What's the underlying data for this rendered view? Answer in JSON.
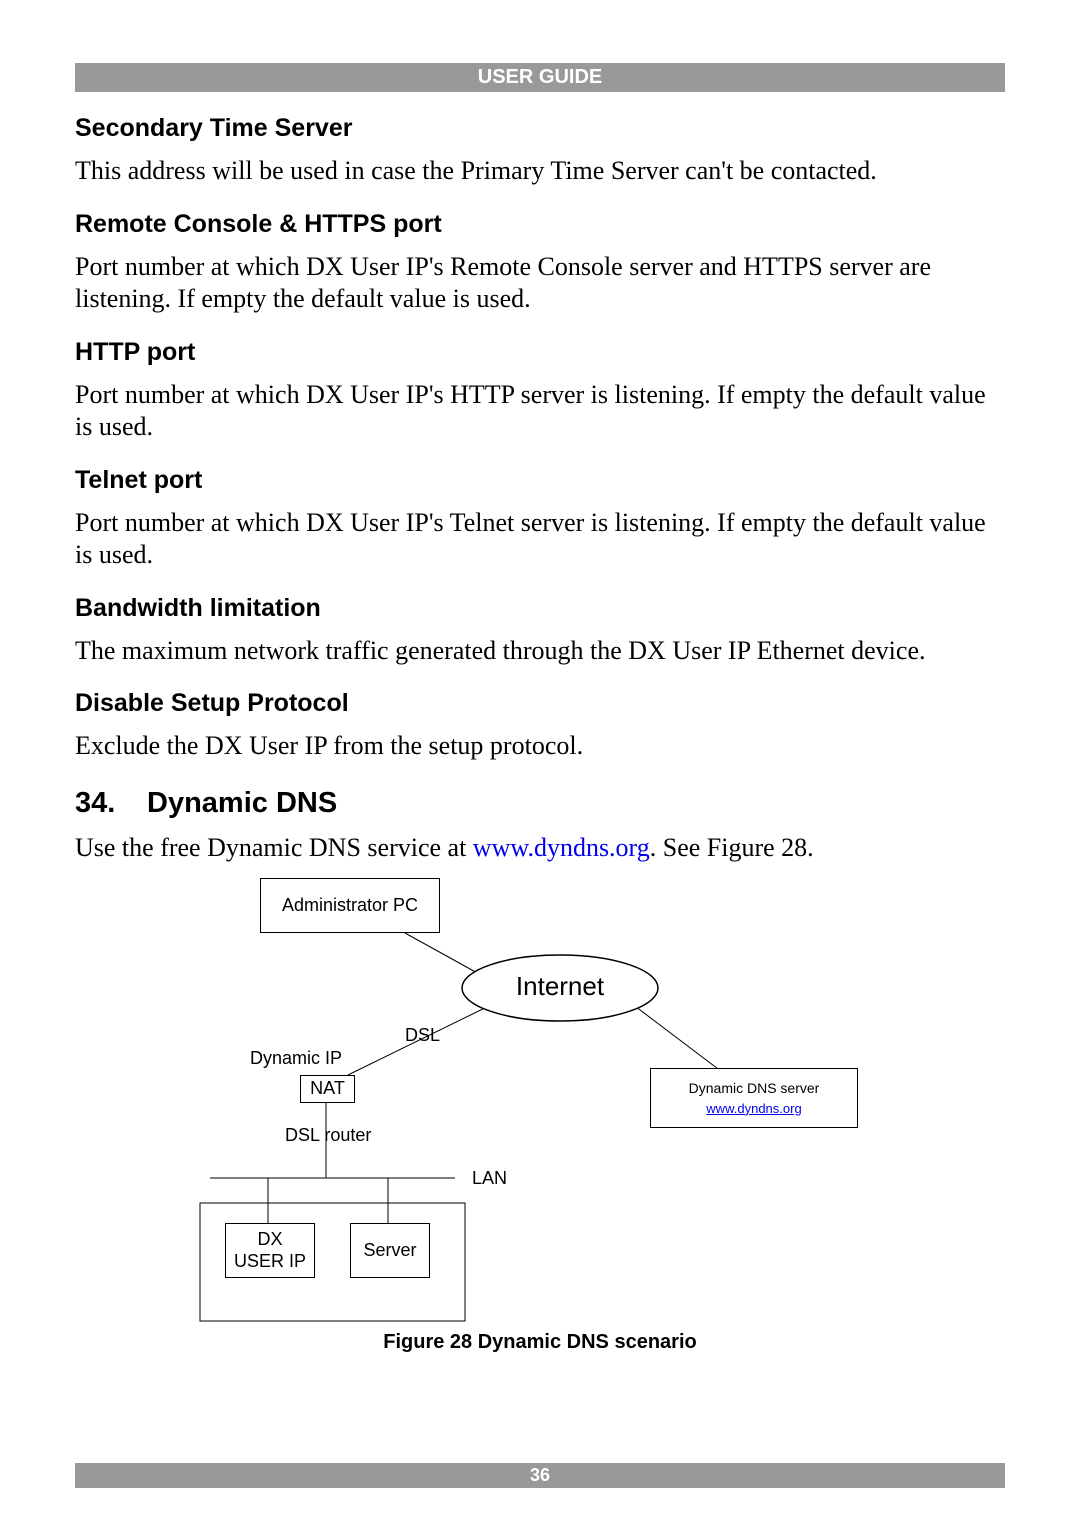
{
  "header": "USER GUIDE",
  "sections": {
    "s1_title": "Secondary Time Server",
    "s1_body": "This address will be used in case the Primary Time Server can't be contacted.",
    "s2_title": "Remote Console & HTTPS port",
    "s2_body": "Port number at which DX User IP's Remote Console server and HTTPS server are listening. If empty the default value is used.",
    "s3_title": "HTTP port",
    "s3_body": "Port number at which DX User IP's HTTP server is listening. If empty the default value is used.",
    "s4_title": "Telnet port",
    "s4_body": "Port number at which DX User IP's Telnet server is listening. If empty the default value is used.",
    "s5_title": "Bandwidth limitation",
    "s5_body": "The maximum network traffic generated through the DX User IP Ethernet device.",
    "s6_title": "Disable Setup Protocol",
    "s6_body": "Exclude the DX User IP from the setup protocol."
  },
  "major": {
    "num": "34.",
    "title": "Dynamic DNS",
    "body_pre": "Use the free Dynamic DNS service at ",
    "body_link": "www.dyndns.org",
    "body_post": ". See Figure 28."
  },
  "diagram": {
    "admin_pc": "Administrator PC",
    "internet": "Internet",
    "dsl": "DSL",
    "dynamic_ip": "Dynamic IP",
    "nat": "NAT",
    "dsl_router": "DSL router",
    "lan": "LAN",
    "dx_user_ip": "DX\nUSER IP",
    "server": "Server",
    "dns_server": "Dynamic DNS server",
    "dns_link": "www.dyndns.org"
  },
  "caption": "Figure 28 Dynamic DNS scenario",
  "footer": "36"
}
